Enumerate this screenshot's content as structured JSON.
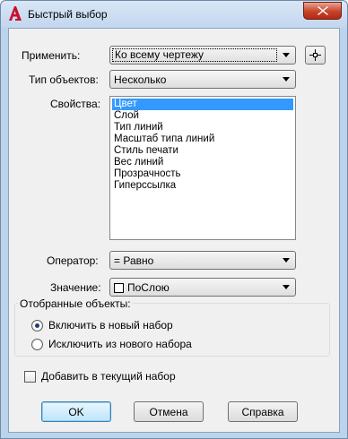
{
  "window": {
    "title": "Быстрый выбор"
  },
  "apply": {
    "label": "Применить:",
    "value": "Ко всему чертежу"
  },
  "object_type": {
    "label": "Тип объектов:",
    "value": "Несколько"
  },
  "properties": {
    "label": "Свойства:",
    "items": [
      "Цвет",
      "Слой",
      "Тип линий",
      "Масштаб типа линий",
      "Стиль печати",
      "Вес линий",
      "Прозрачность",
      "Гиперссылка"
    ],
    "selected_index": 0
  },
  "operator": {
    "label": "Оператор:",
    "value": "= Равно"
  },
  "value_field": {
    "label": "Значение:",
    "value": "ПоСлою"
  },
  "filtered": {
    "title": "Отобранные объекты:",
    "include_label": "Включить в новый набор",
    "exclude_label": "Исключить из нового набора",
    "selected": "include"
  },
  "append": {
    "label": "Добавить в текущий набор",
    "checked": false
  },
  "buttons": {
    "ok": "OK",
    "cancel": "Отмена",
    "help": "Справка"
  },
  "colors": {
    "selection": "#3399ff",
    "close_button": "#c7432a",
    "app_icon": "#c8102e"
  }
}
